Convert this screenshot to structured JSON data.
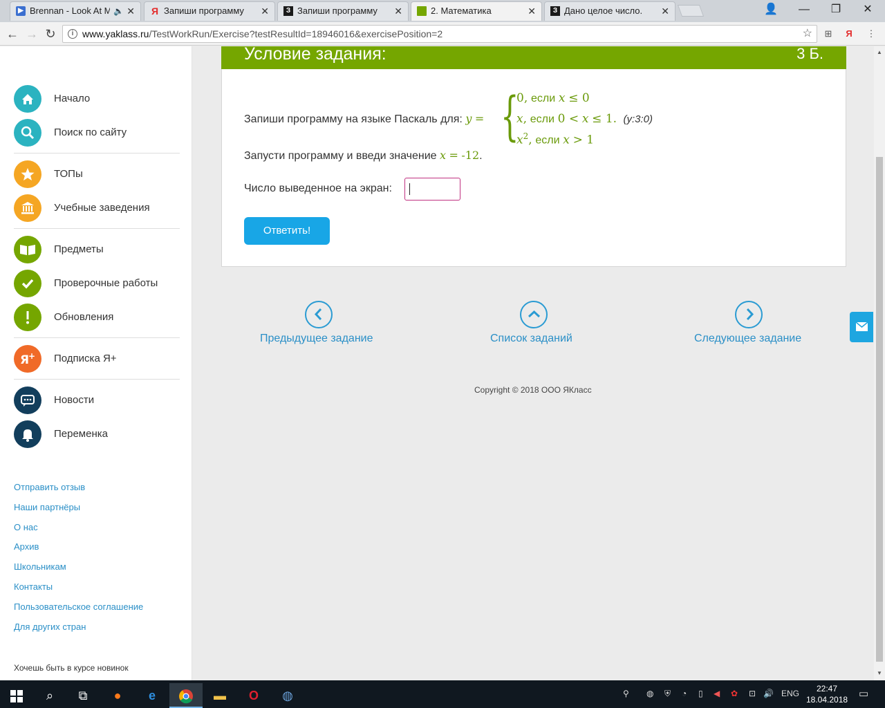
{
  "browser": {
    "tabs": [
      {
        "title": "Brennan - Look At Me",
        "icon": "play-icon",
        "color": "#3b6fd0"
      },
      {
        "title": "Запиши программу на я",
        "icon": "yandex-icon",
        "color": "#e32b2b"
      },
      {
        "title": "Запиши программу на я",
        "icon": "znanija-icon",
        "color": "#1a1a1a"
      },
      {
        "title": "2. Математика",
        "icon": "yaklass-icon",
        "color": "#75a600"
      },
      {
        "title": "Дано целое число. Если",
        "icon": "znanija-icon",
        "color": "#1a1a1a"
      }
    ],
    "url_host": "www.yaklass.ru",
    "url_path": "/TestWorkRun/Exercise?testResultId=18946016&exercisePosition=2"
  },
  "sidebar": {
    "items": [
      {
        "label": "Начало",
        "icon": "home-icon",
        "color": "#2bb3c0"
      },
      {
        "label": "Поиск по сайту",
        "icon": "search-icon",
        "color": "#2bb3c0"
      },
      {
        "label": "ТОПы",
        "icon": "star-icon",
        "color": "#f5a623"
      },
      {
        "label": "Учебные заведения",
        "icon": "institution-icon",
        "color": "#f5a623"
      },
      {
        "label": "Предметы",
        "icon": "book-icon",
        "color": "#75a600"
      },
      {
        "label": "Проверочные работы",
        "icon": "check-icon",
        "color": "#75a600"
      },
      {
        "label": "Обновления",
        "icon": "exclamation-icon",
        "color": "#75a600"
      },
      {
        "label": "Подписка Я+",
        "icon": "yaplus-icon",
        "color": "#f06a28"
      },
      {
        "label": "Новости",
        "icon": "chat-icon",
        "color": "#123e5c"
      },
      {
        "label": "Переменка",
        "icon": "bell-icon",
        "color": "#123e5c"
      }
    ],
    "links": [
      "Отправить отзыв",
      "Наши партнёры",
      "О нас",
      "Архив",
      "Школьникам",
      "Контакты",
      "Пользовательское соглашение",
      "Для других стран"
    ],
    "news_text": "Хочешь быть в курсе новинок"
  },
  "task": {
    "header_title": "Условие задания:",
    "points": "3 Б.",
    "prompt": "Запиши программу на языке Паскаль для:",
    "hint": "(y:3:0)",
    "run_text": "Запусти программу и введи значение",
    "x_value": "-12",
    "answer_label": "Число выведенное на экран:",
    "submit_label": "Ответить!"
  },
  "nav": {
    "prev": "Предыдущее задание",
    "list": "Список заданий",
    "next": "Следующее задание"
  },
  "footer": {
    "copyright": "Copyright © 2018 ООО ЯКласс"
  },
  "taskbar": {
    "lang": "ENG",
    "time": "22:47",
    "date": "18.04.2018"
  }
}
